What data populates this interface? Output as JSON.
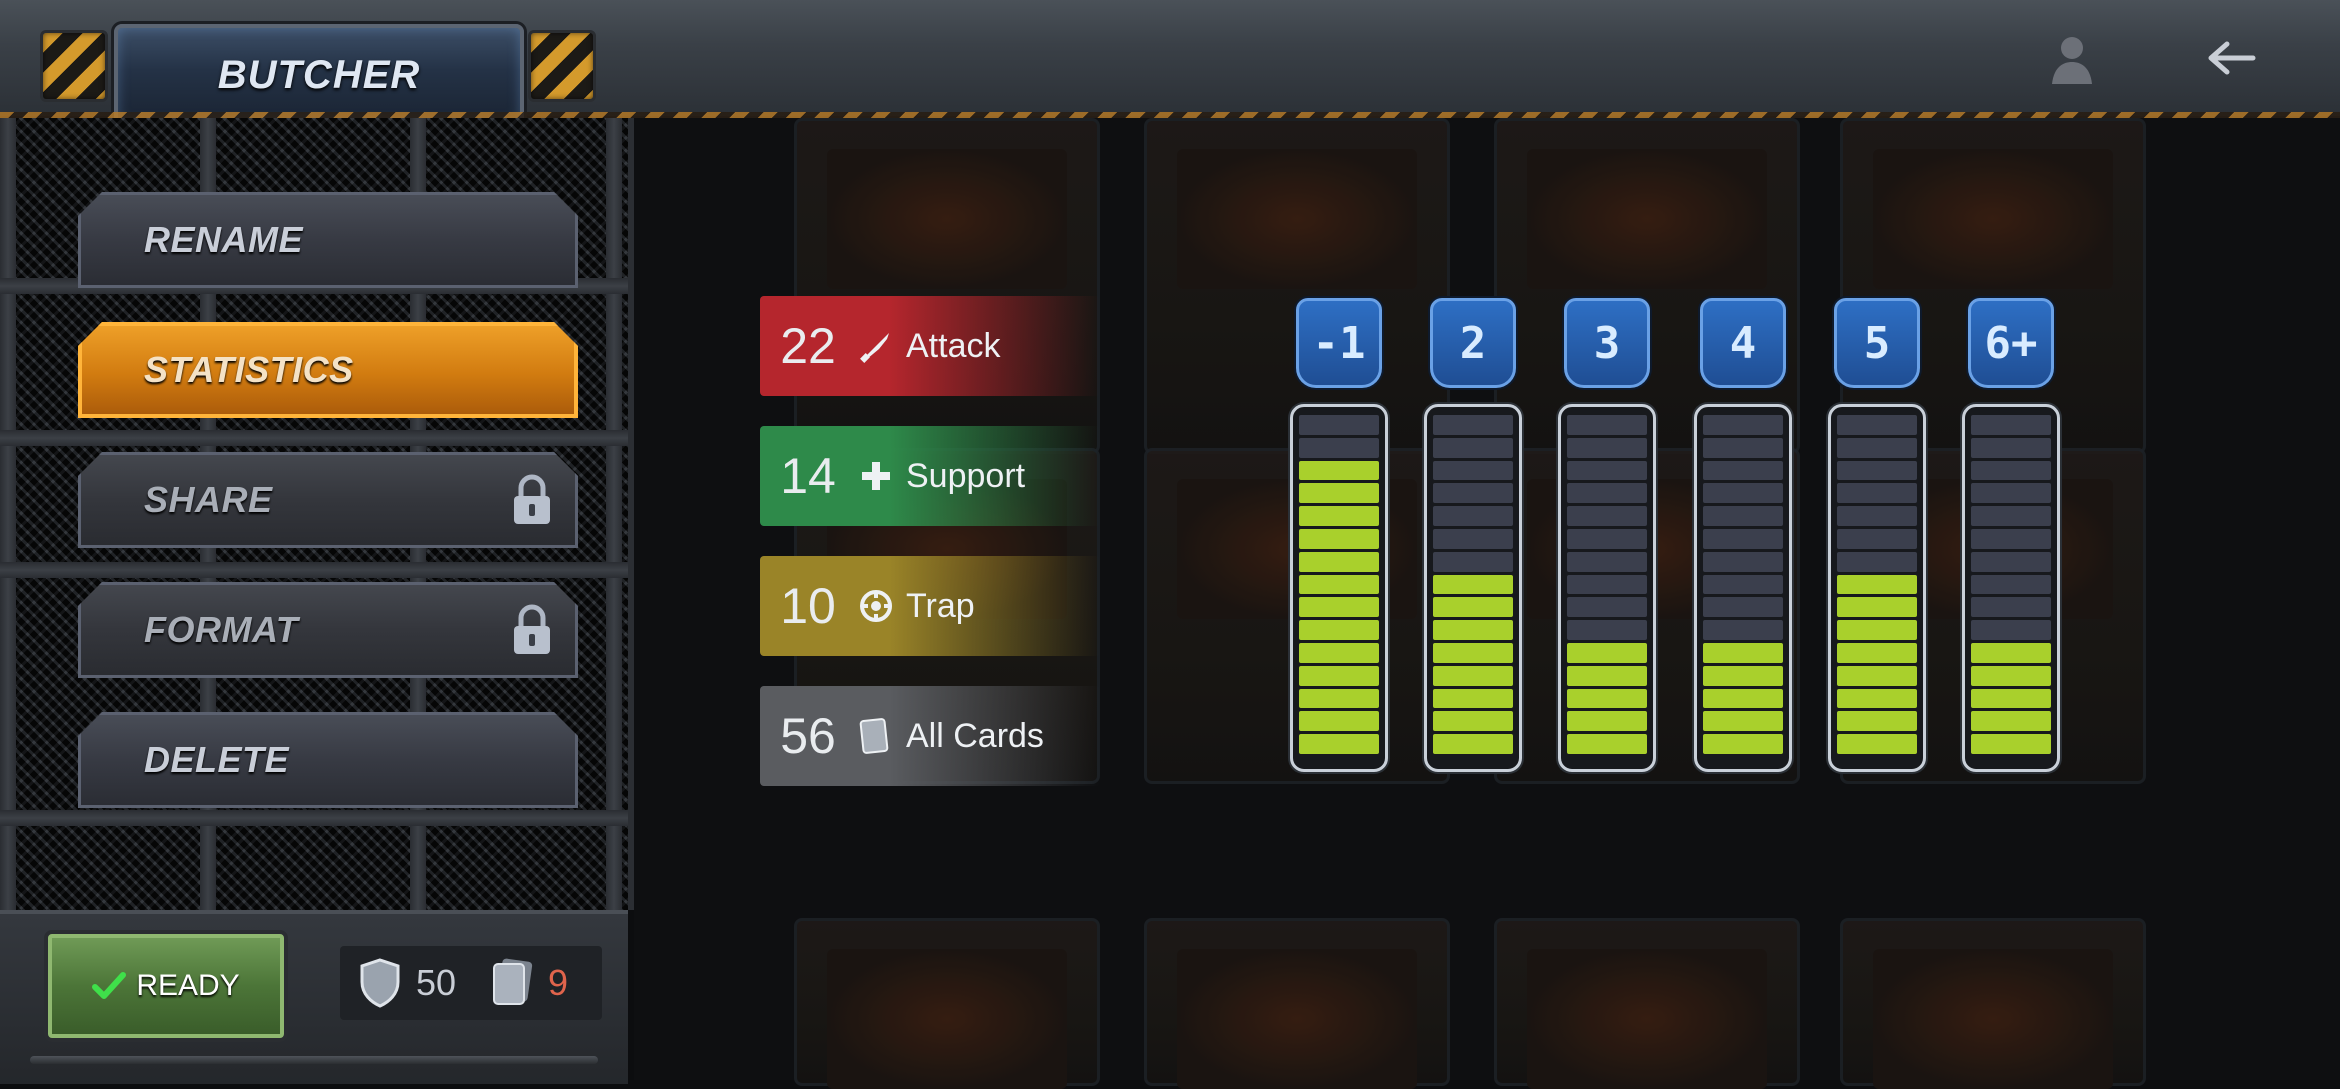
{
  "header": {
    "title": "BUTCHER"
  },
  "menu": {
    "items": [
      {
        "label": "RENAME",
        "state": "normal"
      },
      {
        "label": "STATISTICS",
        "state": "active"
      },
      {
        "label": "SHARE",
        "state": "locked"
      },
      {
        "label": "FORMAT",
        "state": "locked"
      },
      {
        "label": "DELETE",
        "state": "normal"
      }
    ]
  },
  "footer": {
    "ready_label": "READY",
    "shield_count": "50",
    "card_count": "9"
  },
  "stats": [
    {
      "value": "22",
      "label": "Attack",
      "icon": "bullet-icon",
      "color": "#b5262d"
    },
    {
      "value": "14",
      "label": "Support",
      "icon": "plus-icon",
      "color": "#2e8a4a"
    },
    {
      "value": "10",
      "label": "Trap",
      "icon": "trap-icon",
      "color": "#9a8428"
    },
    {
      "value": "56",
      "label": "All Cards",
      "icon": "cards-icon",
      "color": "#5a5c60"
    }
  ],
  "cost_columns": [
    {
      "label": "-1",
      "filled": 13
    },
    {
      "label": "2",
      "filled": 8
    },
    {
      "label": "3",
      "filled": 5
    },
    {
      "label": "4",
      "filled": 5
    },
    {
      "label": "5",
      "filled": 8
    },
    {
      "label": "6+",
      "filled": 5
    }
  ],
  "meter_total_segments": 15,
  "colors": {
    "active_orange": "#d17b10",
    "meter_fill": "#a9d02c",
    "badge_blue": "#1f4e94"
  }
}
